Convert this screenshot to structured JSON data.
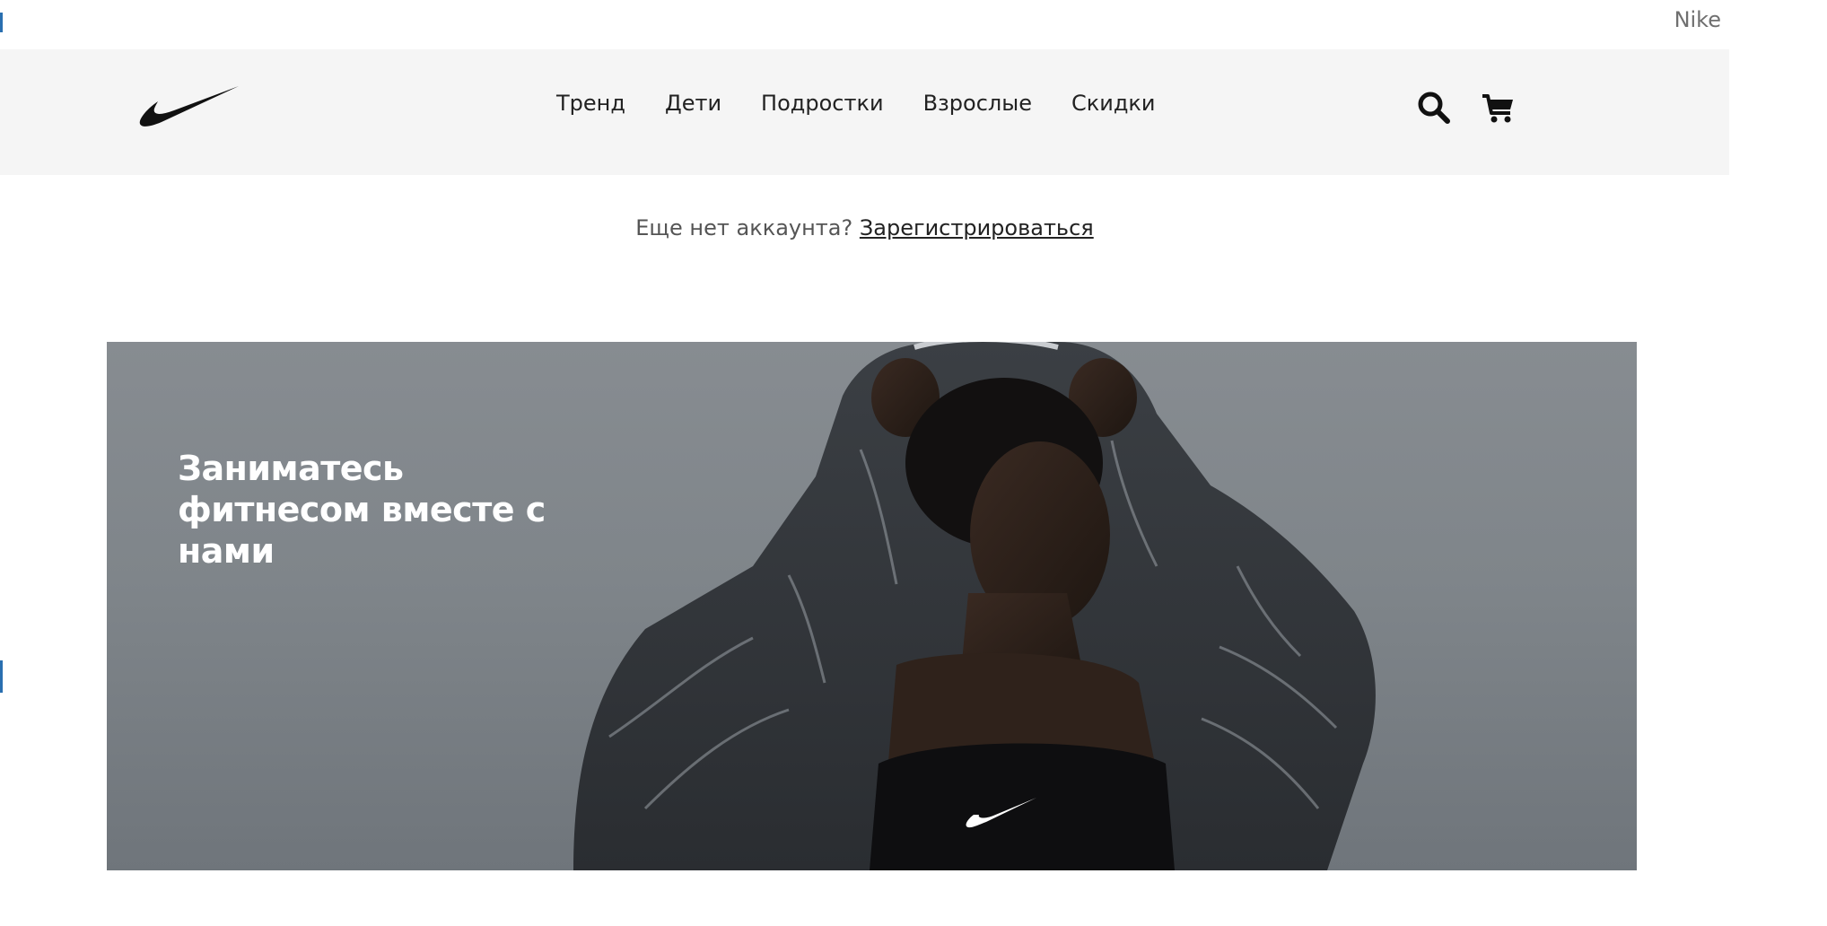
{
  "document": {
    "title": "Nike"
  },
  "header": {
    "logo_icon": "nike-swoosh-icon",
    "nav": [
      {
        "label": "Тренд"
      },
      {
        "label": "Дети"
      },
      {
        "label": "Подростки"
      },
      {
        "label": "Взрослые"
      },
      {
        "label": "Скидки"
      }
    ],
    "search_icon": "search-icon",
    "cart_icon": "cart-icon"
  },
  "signup": {
    "prompt": "Еще нет аккаунта?",
    "link_label": "Зарегистрироваться"
  },
  "hero": {
    "heading": "Заниматесь фитнесом вместе с нами",
    "image": "woman-in-hooded-jacket-photo"
  },
  "colors": {
    "header_bg": "#f5f5f5",
    "hero_bg": "#848a8f",
    "text_dark": "#222222",
    "text_muted": "#555555"
  }
}
